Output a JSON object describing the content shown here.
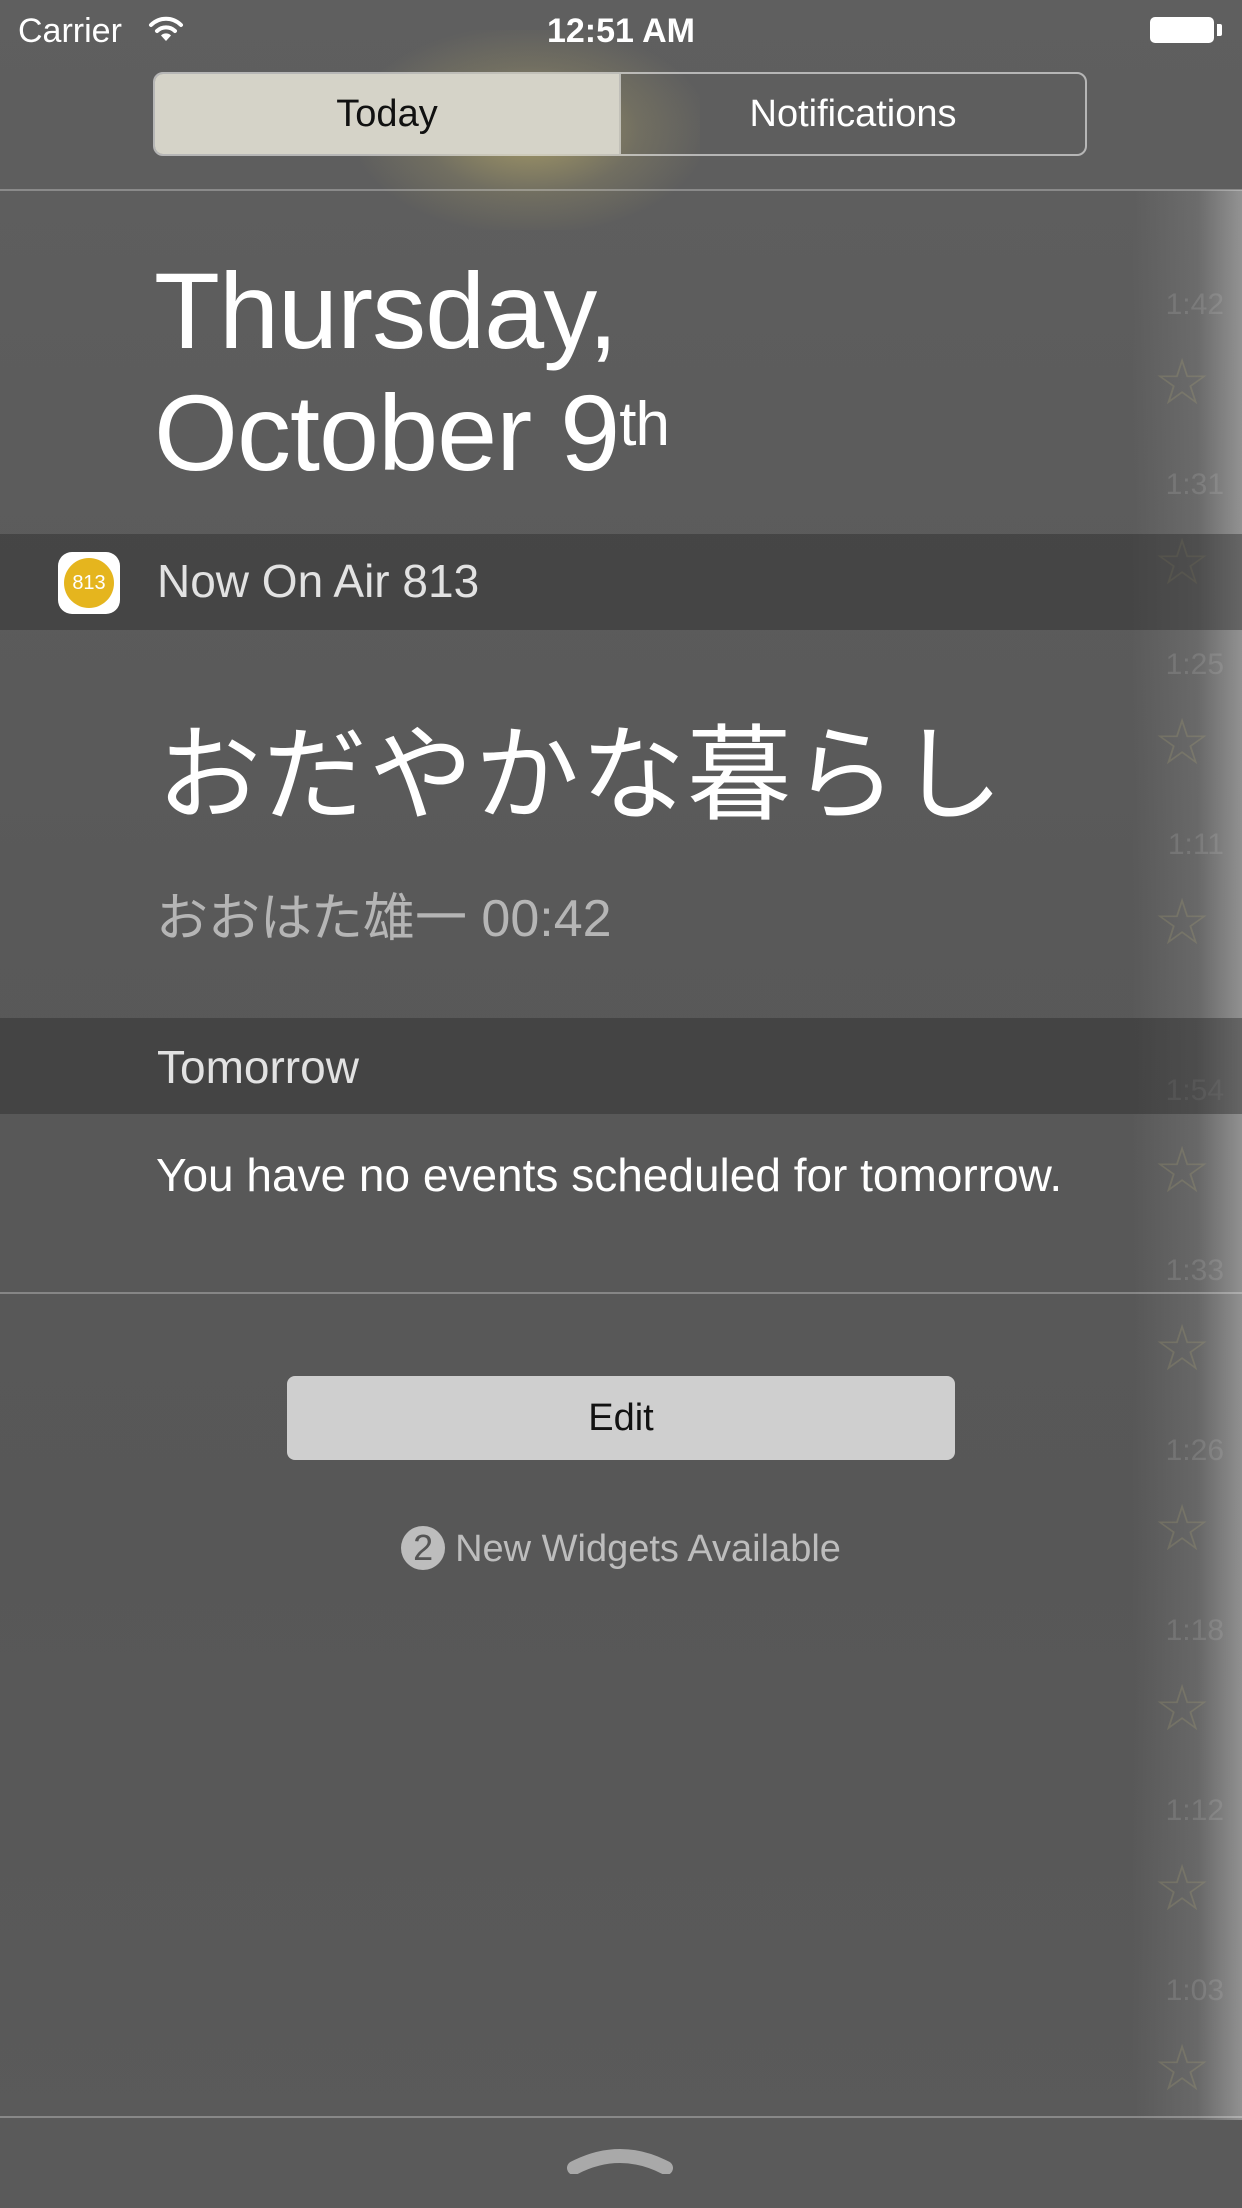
{
  "status_bar": {
    "carrier": "Carrier",
    "time": "12:51 AM",
    "icons": [
      "wifi-icon",
      "battery-icon"
    ]
  },
  "segmented_control": {
    "tabs": [
      {
        "label": "Today",
        "selected": true
      },
      {
        "label": "Notifications",
        "selected": false
      }
    ]
  },
  "date": {
    "weekday": "Thursday,",
    "month_day": "October 9",
    "suffix": "th"
  },
  "widget_now_on_air": {
    "title": "Now On Air 813",
    "icon_text": "813",
    "icon_color": "#e5b51e",
    "song": "おだやかな暮らし",
    "artist_time": "おおはた雄一 00:42"
  },
  "widget_tomorrow": {
    "title": "Tomorrow",
    "message": "You have no events scheduled for tomorrow."
  },
  "edit_button": {
    "label": "Edit"
  },
  "new_widgets": {
    "count": "2",
    "text": "New Widgets Available"
  },
  "background_ghost": {
    "times": [
      "1:42",
      "1:31",
      "1:25",
      "1:11",
      "1:54",
      "1:33",
      "1:26",
      "1:18",
      "1:12",
      "1:03"
    ]
  }
}
